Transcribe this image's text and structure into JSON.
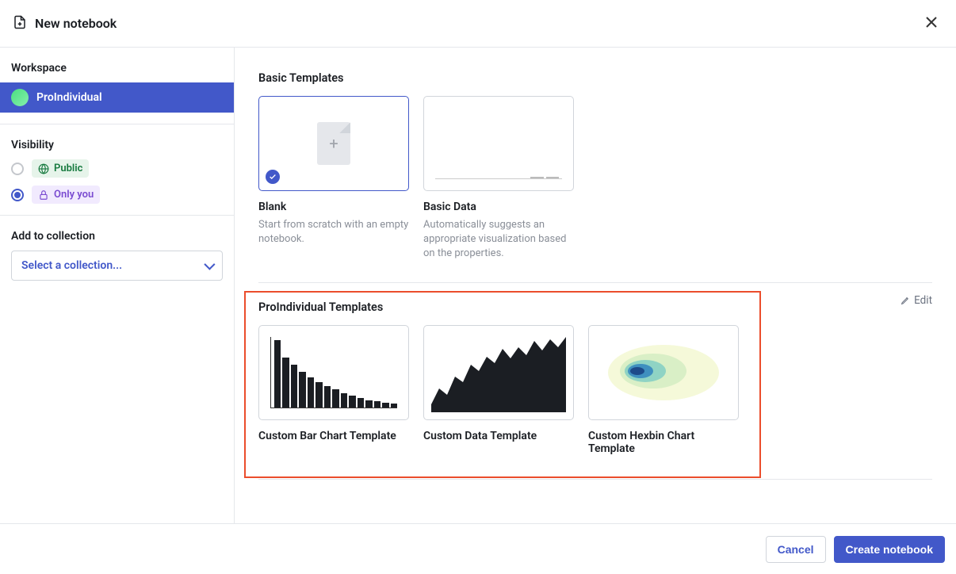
{
  "header": {
    "title": "New notebook"
  },
  "sidebar": {
    "workspace_heading": "Workspace",
    "workspace_name": "ProIndividual",
    "visibility_heading": "Visibility",
    "public_label": "Public",
    "private_label": "Only you",
    "collection_heading": "Add to collection",
    "collection_placeholder": "Select a collection..."
  },
  "main": {
    "basic_heading": "Basic Templates",
    "basic_templates": [
      {
        "title": "Blank",
        "desc": "Start from scratch with an empty notebook."
      },
      {
        "title": "Basic Data",
        "desc": "Automatically suggests an appropriate visualization based on the properties."
      }
    ],
    "pro_heading": "ProIndividual Templates",
    "edit_label": "Edit",
    "pro_templates": [
      {
        "title": "Custom Bar Chart Template"
      },
      {
        "title": "Custom Data Template"
      },
      {
        "title": "Custom Hexbin Chart Template"
      }
    ]
  },
  "footer": {
    "cancel": "Cancel",
    "create": "Create notebook"
  }
}
